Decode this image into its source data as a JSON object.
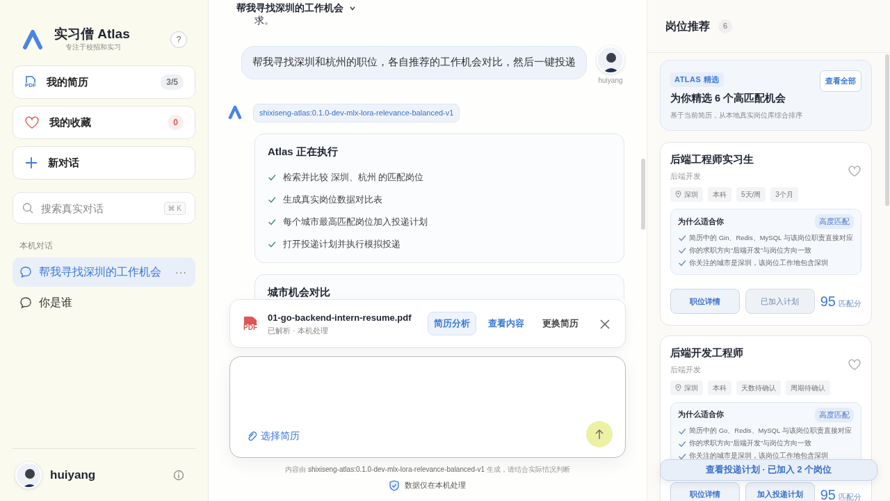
{
  "sidebar": {
    "app_title": "实习僧 Atlas",
    "app_subtitle": "专注于校招和实习",
    "help": "?",
    "nav": [
      {
        "kind": "resume",
        "icon_label": "PDF",
        "label": "我的简历",
        "count": "3/5"
      },
      {
        "kind": "favorites",
        "label": "我的收藏",
        "count": "0"
      },
      {
        "kind": "new",
        "label": "新对话"
      }
    ],
    "search": {
      "placeholder": "搜索真实对话",
      "shortcut": "⌘ K"
    },
    "section_title": "本机对话",
    "conversations": [
      {
        "title": "帮我寻找深圳的工作机会",
        "selected": true,
        "menu": "···"
      },
      {
        "title": "你是谁",
        "selected": false
      }
    ],
    "user": {
      "name": "huiyang"
    }
  },
  "chat": {
    "title": "帮我寻找深圳的工作机会",
    "cut_text": "求。",
    "user_message": {
      "text": "帮我寻找深圳和杭州的职位，各自推荐的工作机会对比，然后一键投递",
      "author": "huiyang"
    },
    "assistant": {
      "model": "shixiseng-atlas:0.1.0-dev-mlx-lora-relevance-balanced-v1",
      "cards": [
        {
          "title": "Atlas 正在执行",
          "steps": [
            {
              "text": "检索并比较 深圳、杭州 的匹配岗位",
              "done": true
            },
            {
              "text": "生成真实岗位数据对比表",
              "done": true
            },
            {
              "text": "每个城市最高匹配岗位加入投递计划",
              "done": true
            },
            {
              "text": "打开投递计划并执行模拟投递",
              "done": true
            }
          ]
        },
        {
          "title": "城市机会对比"
        }
      ]
    }
  },
  "attachment": {
    "icon_label": "PDF",
    "filename": "01-go-backend-intern-resume.pdf",
    "status": "已解析 · 本机处理",
    "actions": [
      {
        "label": "简历分析",
        "kind": "soft"
      },
      {
        "label": "查看内容",
        "kind": "link"
      },
      {
        "label": "更换简历",
        "kind": "plain"
      }
    ]
  },
  "composer": {
    "attach_label": "选择简历"
  },
  "footer_note": "内容由 **shixiseng-atlas:0.1.0-dev-mlx-lora-relevance-balanced-v1** 生成，请结合实际情况判断",
  "privacy": "数据仅在本机处理",
  "recommendations": {
    "title": "岗位推荐",
    "count": "6",
    "summary": {
      "tag": "ATLAS 精选",
      "title": "为你精选 6 个高匹配机会",
      "subtitle": "基于当前简历，从本地真实岗位库综合排序",
      "button": "查看全部"
    },
    "jobs": [
      {
        "title": "后端工程师实习生",
        "category": "后端开发",
        "favorited": false,
        "tags": [
          {
            "kind": "location",
            "text": "深圳"
          },
          {
            "kind": "plain",
            "text": "本科"
          },
          {
            "kind": "plain",
            "text": "5天/周"
          },
          {
            "kind": "plain",
            "text": "3个月"
          }
        ],
        "why_title": "为什么适合你",
        "match_label": "高度匹配",
        "reasons": [
          "简历中的 Gin、Redis、MySQL 与该岗位职责直接对应",
          "你的求职方向“后端开发”与岗位方向一致",
          "你关注的城市是深圳，该岗位工作地包含深圳"
        ],
        "detail_button": "职位详情",
        "plan_button": "已加入计划",
        "in_plan": true,
        "score": "95",
        "score_label": "匹配分"
      },
      {
        "title": "后端开发工程师",
        "category": "后端开发",
        "favorited": false,
        "tags": [
          {
            "kind": "location",
            "text": "深圳"
          },
          {
            "kind": "plain",
            "text": "本科"
          },
          {
            "kind": "plain",
            "text": "天数待确认"
          },
          {
            "kind": "plain",
            "text": "周期待确认"
          }
        ],
        "why_title": "为什么适合你",
        "match_label": "高度匹配",
        "reasons": [
          "简历中的 Go、Redis、MySQL 与该岗位职责直接对应",
          "你的求职方向“后端开发”与岗位方向一致",
          "你关注的城市是深圳，该岗位工作地包含深圳"
        ],
        "detail_button": "职位详情",
        "plan_button": "加入投递计划",
        "in_plan": false,
        "score": "95",
        "score_label": "匹配分"
      }
    ],
    "plan_summary_button": "查看投递计划 · 已加入 2 个岗位"
  }
}
